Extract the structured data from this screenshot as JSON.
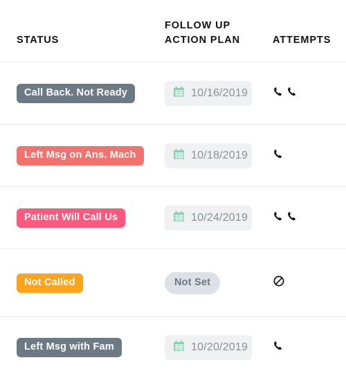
{
  "table": {
    "columns": [
      {
        "key": "status",
        "label": "STATUS"
      },
      {
        "key": "followup",
        "label": "FOLLOW UP\nACTION PLAN"
      },
      {
        "key": "attempts",
        "label": "ATTEMPTS"
      }
    ],
    "rows": [
      {
        "status_label": "Call Back. Not Ready",
        "status_color": "#6b7a85",
        "followup_type": "date",
        "followup_value": "10/16/2019",
        "attempts_icon": "phone-missed-double-icon",
        "attempts_count": 2
      },
      {
        "status_label": "Left Msg on Ans. Mach",
        "status_color": "#f4726e",
        "followup_type": "date",
        "followup_value": "10/18/2019",
        "attempts_icon": "phone-icon",
        "attempts_count": 1
      },
      {
        "status_label": "Patient Will Call Us",
        "status_color": "#fb5a7e",
        "followup_type": "date",
        "followup_value": "10/24/2019",
        "attempts_icon": "phone-missed-double-icon",
        "attempts_count": 2
      },
      {
        "status_label": "Not Called",
        "status_color": "#ffa41c",
        "followup_type": "notset",
        "followup_value": "Not Set",
        "attempts_icon": "no-entry-icon",
        "attempts_count": 0
      },
      {
        "status_label": "Left Msg with Fam",
        "status_color": "#6b7a85",
        "followup_type": "date",
        "followup_value": "10/20/2019",
        "attempts_icon": "phone-icon",
        "attempts_count": 1
      }
    ]
  },
  "colors": {
    "calendar_icon": "#7fd6ae",
    "date_field_bg": "#f0f1f3",
    "date_text": "#8a8f98",
    "notset_bg": "#dde1e7",
    "notset_text": "#6c7580",
    "divider": "#e8eaed",
    "header_text": "#111111"
  }
}
